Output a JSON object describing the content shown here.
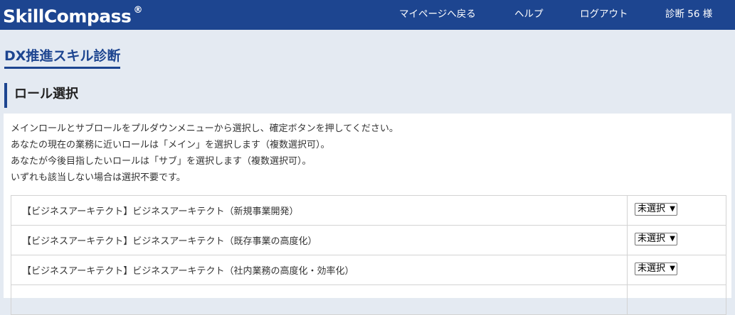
{
  "header": {
    "logo": "SkillCompass",
    "logo_mark": "®",
    "nav": {
      "mypage": "マイページへ戻る",
      "help": "ヘルプ",
      "logout": "ログアウト",
      "user": "診断 56 様"
    }
  },
  "page_title": "DX推進スキル診断",
  "section_title": "ロール選択",
  "instructions": [
    "メインロールとサブロールをプルダウンメニューから選択し、確定ボタンを押してください。",
    "あなたの現在の業務に近いロールは「メイン」を選択します（複数選択可）。",
    "あなたが今後目指したいロールは「サブ」を選択します（複数選択可）。",
    "いずれも該当しない場合は選択不要です。"
  ],
  "roles": [
    {
      "name": "【ビジネスアーキテクト】ビジネスアーキテクト（新規事業開発）",
      "selected": "未選択"
    },
    {
      "name": "【ビジネスアーキテクト】ビジネスアーキテクト（既存事業の高度化）",
      "selected": "未選択"
    },
    {
      "name": "【ビジネスアーキテクト】ビジネスアーキテクト（社内業務の高度化・効率化）",
      "selected": "未選択"
    }
  ],
  "colors": {
    "header_bg": "#1d4590",
    "page_bg": "#e4eaf2",
    "accent": "#1d4590"
  },
  "icons": {
    "select_arrow": "chevron-down-icon"
  }
}
